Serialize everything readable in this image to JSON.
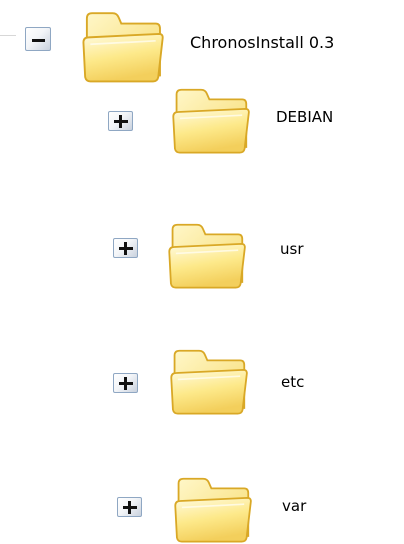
{
  "tree": {
    "root": {
      "label": "ChronosInstall 0.3",
      "expanded": true,
      "toggle_icon": "minus-icon",
      "icon": "folder-icon"
    },
    "children": [
      {
        "label": "DEBIAN",
        "expanded": false,
        "toggle_icon": "plus-icon",
        "icon": "folder-icon"
      },
      {
        "label": "usr",
        "expanded": false,
        "toggle_icon": "plus-icon",
        "icon": "folder-icon"
      },
      {
        "label": "etc",
        "expanded": false,
        "toggle_icon": "plus-icon",
        "icon": "folder-icon"
      },
      {
        "label": "var",
        "expanded": false,
        "toggle_icon": "plus-icon",
        "icon": "folder-icon"
      }
    ]
  },
  "colors": {
    "folder_light": "#fff6c0",
    "folder_mid": "#fde98a",
    "folder_outline": "#d9a826",
    "toggle_border": "#8fa7c3"
  }
}
